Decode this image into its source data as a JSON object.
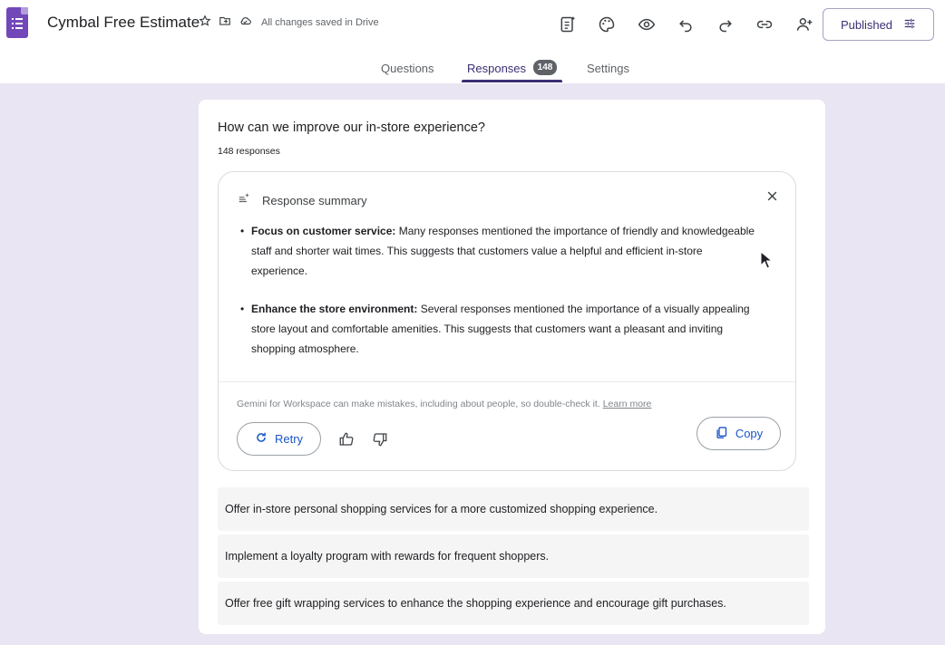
{
  "app": {
    "title": "Cymbal Free Estimate",
    "save_status": "All changes saved in Drive",
    "published_label": "Published"
  },
  "tabs": [
    {
      "label": "Questions"
    },
    {
      "label": "Responses",
      "badge": "148"
    },
    {
      "label": "Settings"
    }
  ],
  "question": {
    "text": "How can we improve our in-store experience?",
    "response_count": "148 responses"
  },
  "summary": {
    "heading": "Response summary",
    "bullets": [
      {
        "bold": "Focus on customer service:",
        "text": " Many responses mentioned the importance of friendly and knowledgeable staff and shorter wait times. This suggests that customers value a helpful and efficient in-store experience."
      },
      {
        "bold": "Enhance the store environment:",
        "text": " Several responses mentioned the importance of a visually appealing store layout and comfortable amenities. This suggests that customers want a pleasant and inviting shopping atmosphere."
      }
    ],
    "disclaimer": "Gemini for Workspace can make mistakes, including about people, so double-check it.",
    "learn_more": "Learn more",
    "retry_label": "Retry",
    "copy_label": "Copy"
  },
  "responses": [
    "Offer in-store personal shopping services for a more customized shopping experience.",
    "Implement a loyalty program with rewards for frequent shoppers.",
    "Offer free gift wrapping services to enhance the shopping experience and encourage gift purchases."
  ],
  "colors": {
    "accent": "#3b2f73",
    "brand_purple": "#7248b9",
    "link_blue": "#1a56c9",
    "page_bg": "#e9e5f3"
  },
  "icons": [
    "forms-logo-icon",
    "star-icon",
    "move-folder-icon",
    "cloud-icon",
    "addon-icon",
    "palette-icon",
    "preview-eye-icon",
    "undo-icon",
    "redo-icon",
    "link-icon",
    "add-collaborator-icon",
    "tune-icon",
    "sparkle-summary-icon",
    "close-icon",
    "refresh-icon",
    "thumbs-up-icon",
    "thumbs-down-icon",
    "copy-icon",
    "mouse-cursor-icon"
  ]
}
